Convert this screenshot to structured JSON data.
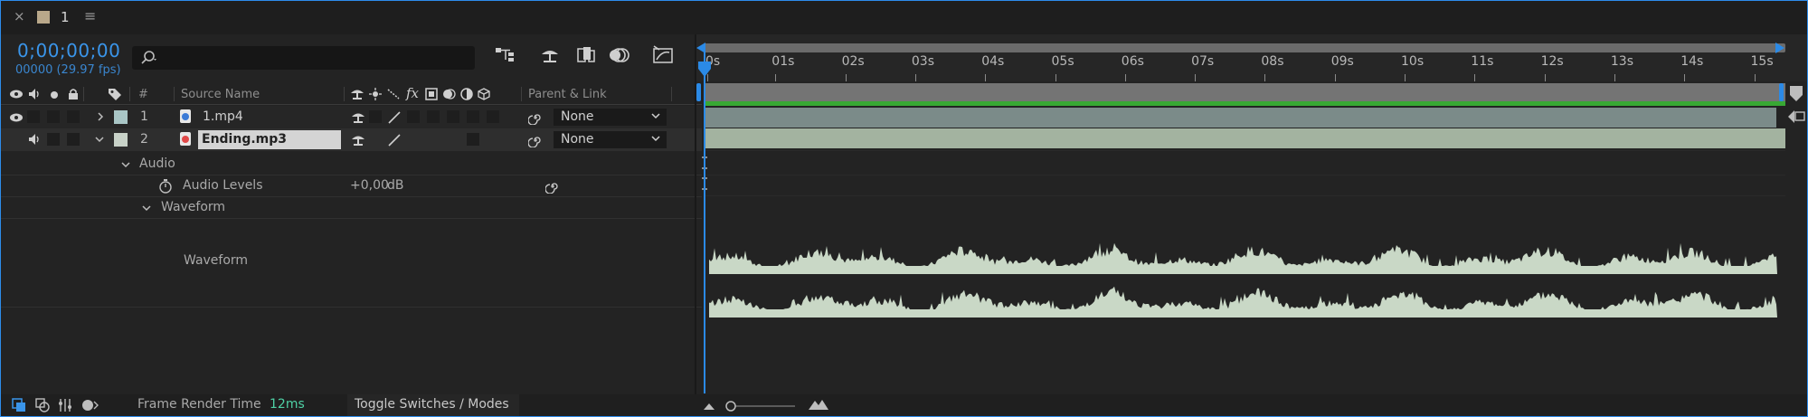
{
  "panel": {
    "close_glyph": "×",
    "comp_name": "1",
    "menu_glyph": "≡",
    "swatch_color": "#b9a88a"
  },
  "timecode": {
    "current": "0;00;00;00",
    "frame_info": "00000 (29.97 fps)"
  },
  "search": {
    "placeholder": "",
    "icon": "search-icon"
  },
  "columns": {
    "number": "#",
    "source_name": "Source Name",
    "parent_link": "Parent & Link",
    "fx_glyph": "fx"
  },
  "layers": [
    {
      "number": "1",
      "name": "1.mp4",
      "parent": "None",
      "label_color": "#a9c6c6",
      "icon": "video-file-icon",
      "icon_color": "#3a7ad6"
    },
    {
      "number": "2",
      "name": "Ending.mp3",
      "parent": "None",
      "label_color": "#c8d2c8",
      "icon": "audio-file-icon",
      "icon_color": "#e04848"
    }
  ],
  "audio_group": {
    "label": "Audio",
    "levels_label": "Audio Levels",
    "levels_value": "+0,00",
    "levels_unit": "dB",
    "waveform_group": "Waveform",
    "waveform_label": "Waveform"
  },
  "ruler": {
    "labels": [
      "0s",
      "01s",
      "02s",
      "03s",
      "04s",
      "05s",
      "06s",
      "07s",
      "08s",
      "09s",
      "10s",
      "11s",
      "12s",
      "13s",
      "14s",
      "15s"
    ]
  },
  "bottom_bar": {
    "render_label": "Frame Render Time",
    "render_value": "12ms",
    "toggle_label": "Toggle Switches / Modes"
  },
  "colors": {
    "accent_blue": "#2d8ceb",
    "timecode_blue": "#3a95ea",
    "work_bar_green": "#38a834",
    "render_value_green": "#4fd1a5"
  }
}
